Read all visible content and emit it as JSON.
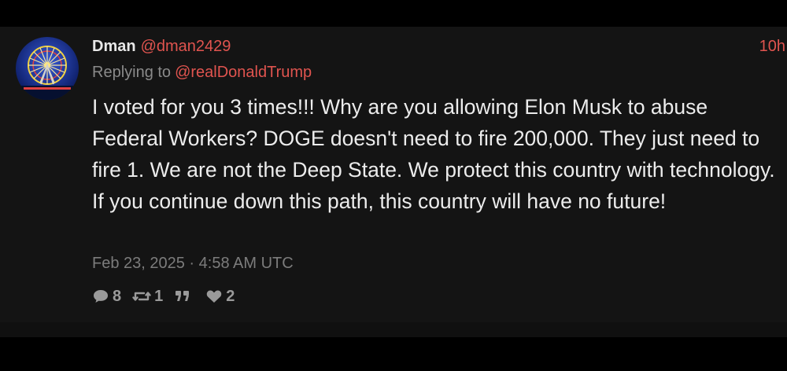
{
  "tweet": {
    "display_name": "Dman",
    "handle": "@dman2429",
    "time_ago": "10h",
    "replying_label": "Replying to",
    "replying_handle": "@realDonaldTrump",
    "body": "I voted for you 3 times!!! Why are you allowing Elon Musk to abuse Federal Workers? DOGE doesn't need to fire 200,000. They just need to fire 1. We are not the Deep State. We protect this country with technology. If you continue down this path, this country will have no future!",
    "timestamp": "Feb 23, 2025 · 4:58 AM UTC",
    "stats": {
      "comments": "8",
      "retweets": "1",
      "quotes": "",
      "likes": "2"
    }
  },
  "icons": {
    "avatar": "ferris-wheel-avatar",
    "comment": "comment-icon",
    "retweet": "retweet-icon",
    "quote": "quote-icon",
    "like": "heart-icon"
  },
  "colors": {
    "background": "#141414",
    "accent": "#e0544f",
    "text": "#ececec",
    "muted": "#7c7c7c"
  }
}
